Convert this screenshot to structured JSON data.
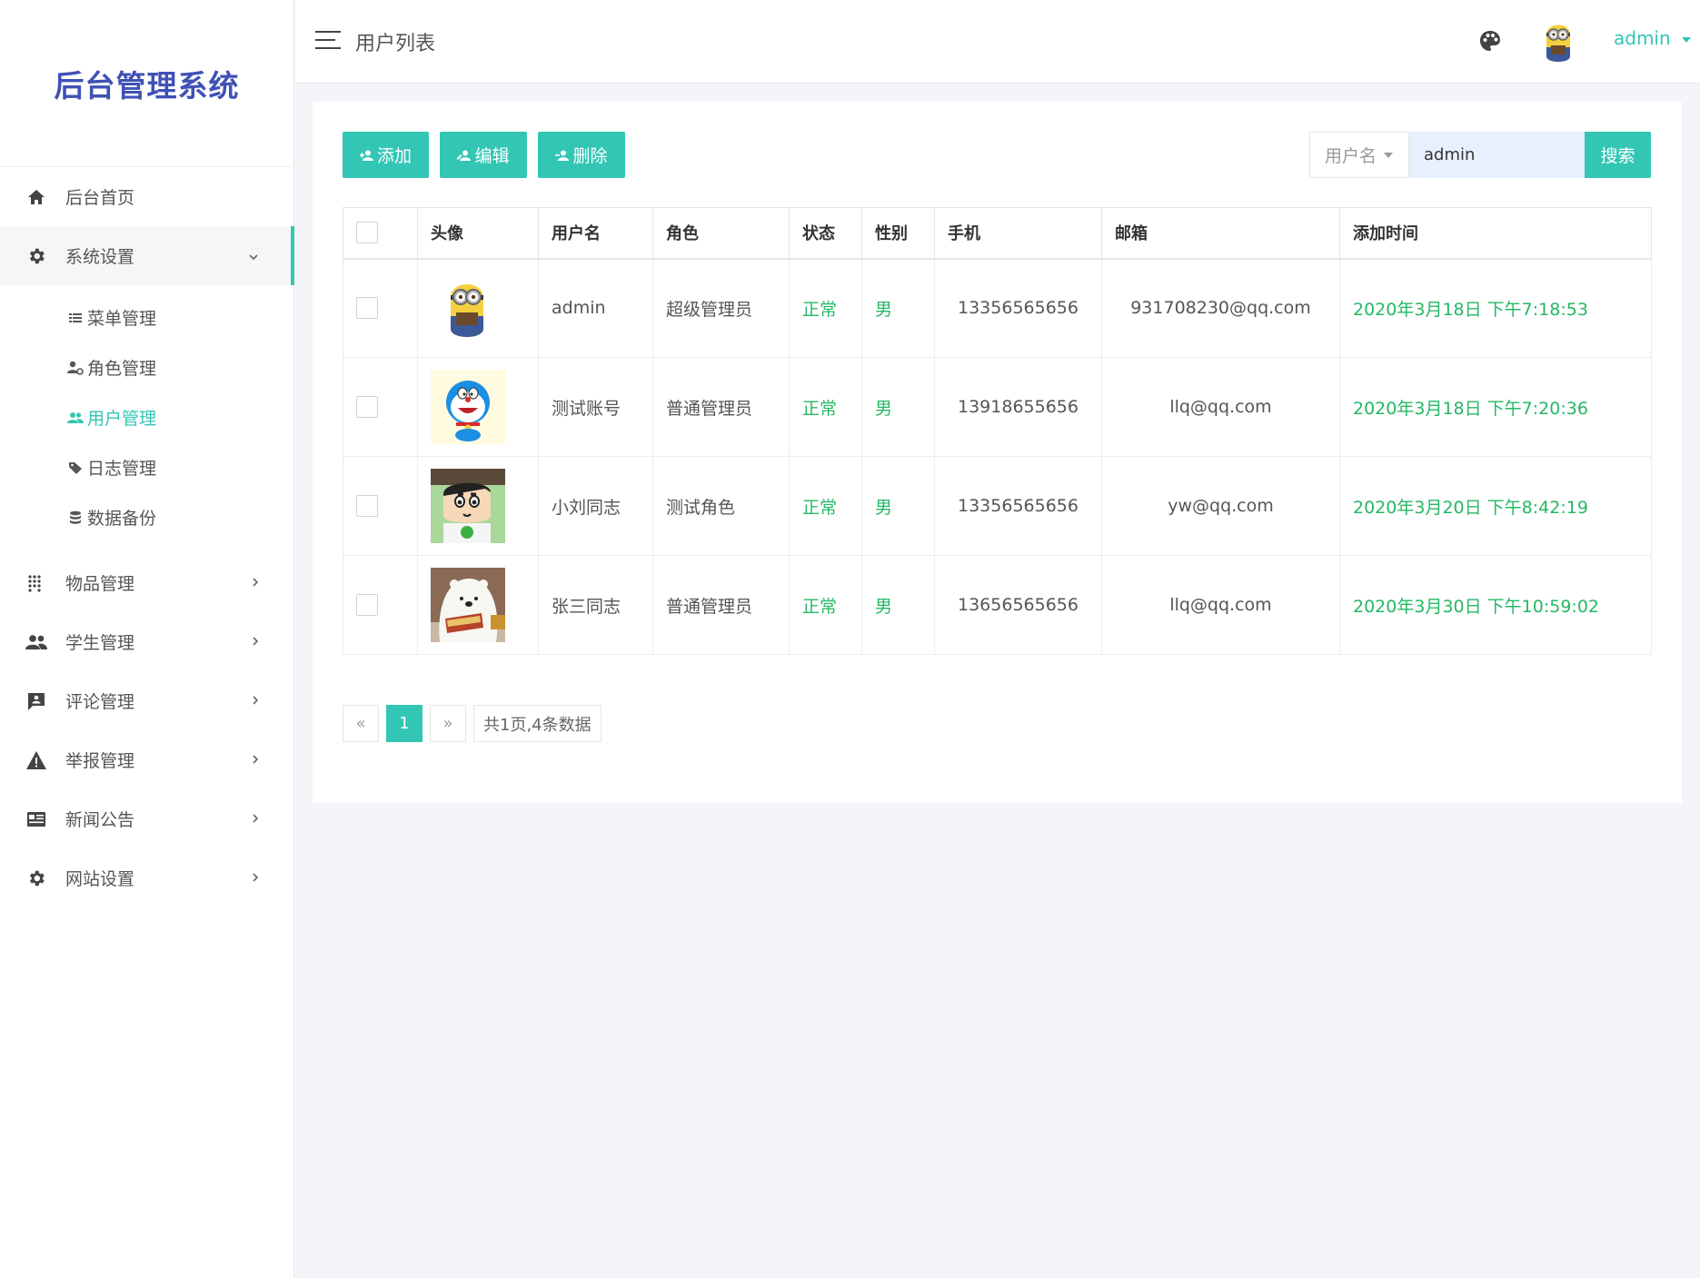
{
  "sidebar": {
    "logo": "后台管理系统",
    "menu": [
      {
        "label": "后台首页",
        "icon": "home-icon"
      },
      {
        "label": "系统设置",
        "icon": "gear-icon",
        "open": true,
        "children": [
          {
            "label": "菜单管理",
            "icon": "list-icon"
          },
          {
            "label": "角色管理",
            "icon": "user-cog-icon"
          },
          {
            "label": "用户管理",
            "icon": "users-icon",
            "active": true
          },
          {
            "label": "日志管理",
            "icon": "tag-icon"
          },
          {
            "label": "数据备份",
            "icon": "database-icon"
          }
        ]
      },
      {
        "label": "物品管理",
        "icon": "grid-dots-icon"
      },
      {
        "label": "学生管理",
        "icon": "people-icon"
      },
      {
        "label": "评论管理",
        "icon": "comment-icon"
      },
      {
        "label": "举报管理",
        "icon": "warning-icon"
      },
      {
        "label": "新闻公告",
        "icon": "news-icon"
      },
      {
        "label": "网站设置",
        "icon": "gear-icon"
      }
    ]
  },
  "header": {
    "title": "用户列表",
    "username": "admin"
  },
  "toolbar": {
    "add": "添加",
    "edit": "编辑",
    "delete": "删除"
  },
  "search": {
    "field": "用户名",
    "value": "admin",
    "button": "搜索"
  },
  "table": {
    "headers": [
      "头像",
      "用户名",
      "角色",
      "状态",
      "性别",
      "手机",
      "邮箱",
      "添加时间"
    ],
    "rows": [
      {
        "avatar": "minion",
        "username": "admin",
        "role": "超级管理员",
        "status": "正常",
        "gender": "男",
        "phone": "13356565656",
        "email": "931708230@qq.com",
        "created": "2020年3月18日 下午7:18:53"
      },
      {
        "avatar": "doraemon",
        "username": "测试账号",
        "role": "普通管理员",
        "status": "正常",
        "gender": "男",
        "phone": "13918655656",
        "email": "llq@qq.com",
        "created": "2020年3月18日 下午7:20:36"
      },
      {
        "avatar": "shinchan",
        "username": "小刘同志",
        "role": "测试角色",
        "status": "正常",
        "gender": "男",
        "phone": "13356565656",
        "email": "yw@qq.com",
        "created": "2020年3月20日 下午8:42:19"
      },
      {
        "avatar": "icebear",
        "username": "张三同志",
        "role": "普通管理员",
        "status": "正常",
        "gender": "男",
        "phone": "13656565656",
        "email": "llq@qq.com",
        "created": "2020年3月30日 下午10:59:02"
      }
    ]
  },
  "pagination": {
    "prev": "«",
    "current": "1",
    "next": "»",
    "info": "共1页,4条数据"
  },
  "colors": {
    "accent": "#33c6b4",
    "logo": "#3f51b5",
    "green_text": "#25b864"
  }
}
